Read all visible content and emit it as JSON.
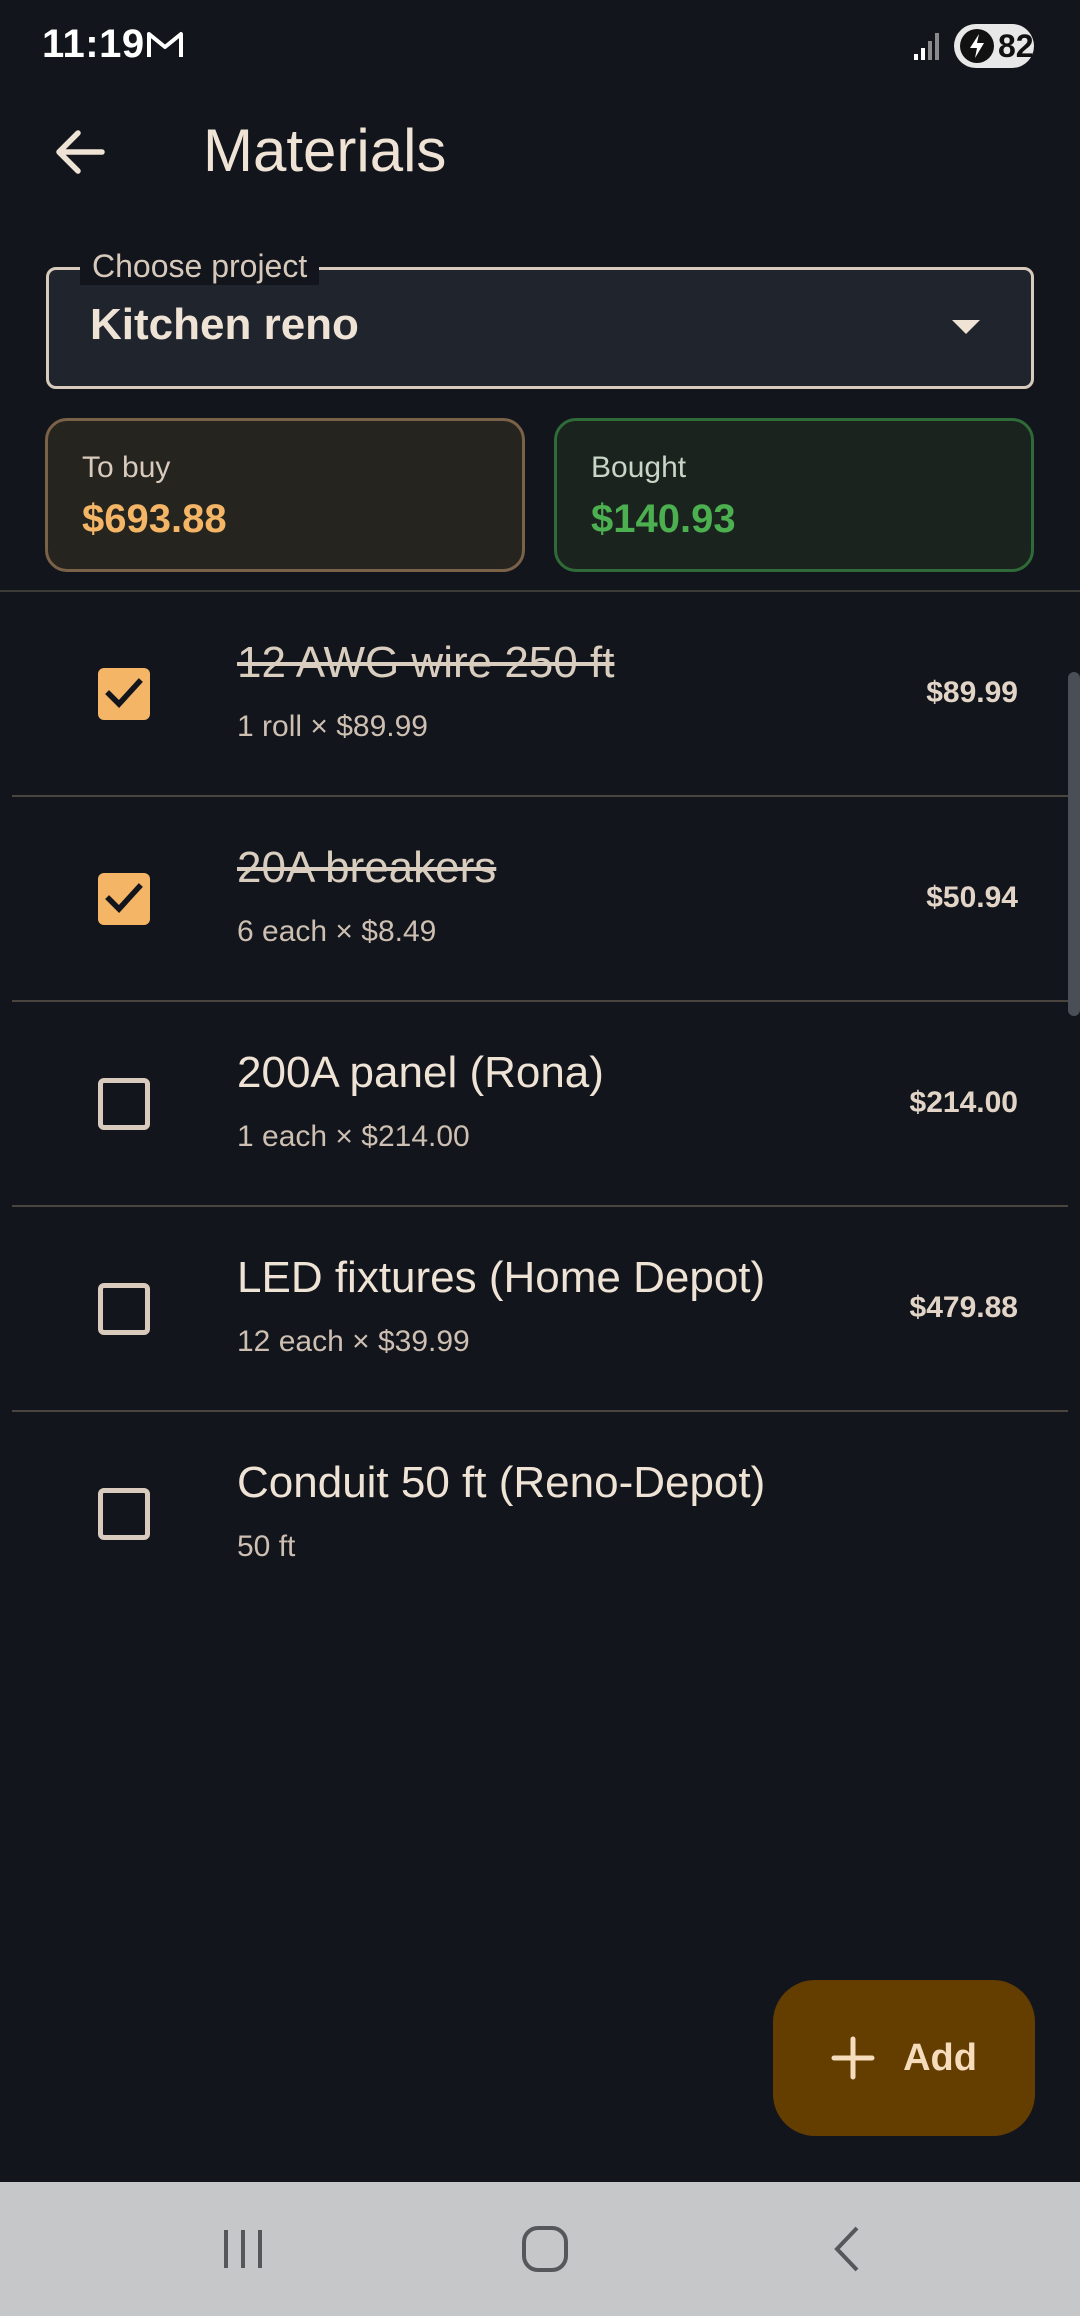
{
  "status_bar": {
    "time": "11:19",
    "battery": "82"
  },
  "header": {
    "title": "Materials"
  },
  "project": {
    "label": "Choose project",
    "value": "Kitchen reno"
  },
  "summary": {
    "to_buy": {
      "label": "To buy",
      "value": "$693.88"
    },
    "bought": {
      "label": "Bought",
      "value": "$140.93"
    }
  },
  "items": [
    {
      "name": "12 AWG wire 250 ft",
      "detail": "1 roll × $89.99",
      "total": "$89.99",
      "checked": true
    },
    {
      "name": "20A breakers",
      "detail": "6 each × $8.49",
      "total": "$50.94",
      "checked": true
    },
    {
      "name": "200A panel (Rona)",
      "detail": "1 each × $214.00",
      "total": "$214.00",
      "checked": false
    },
    {
      "name": "LED fixtures (Home Depot)",
      "detail": "12 each × $39.99",
      "total": "$479.88",
      "checked": false
    },
    {
      "name": "Conduit 50 ft (Reno-Depot)",
      "detail": "50 ft",
      "total": "",
      "checked": false
    }
  ],
  "fab": {
    "label": "Add"
  },
  "colors": {
    "accent": "#f4b566",
    "bought_green": "#4caf50",
    "fab_bg": "#643e00",
    "background": "#12151b"
  }
}
